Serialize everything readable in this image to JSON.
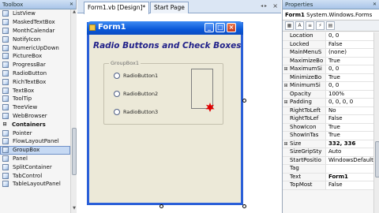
{
  "toolbox": {
    "title": "Toolbox",
    "close_glyph": "✕",
    "items": [
      {
        "label": "ListView",
        "kind": "item",
        "icon": "listview-icon"
      },
      {
        "label": "MaskedTextBox",
        "kind": "item",
        "icon": "maskedtextbox-icon"
      },
      {
        "label": "MonthCalendar",
        "kind": "item",
        "icon": "monthcalendar-icon"
      },
      {
        "label": "NotifyIcon",
        "kind": "item",
        "icon": "notifyicon-icon"
      },
      {
        "label": "NumericUpDown",
        "kind": "item",
        "icon": "numericupdown-icon"
      },
      {
        "label": "PictureBox",
        "kind": "item",
        "icon": "picturebox-icon"
      },
      {
        "label": "ProgressBar",
        "kind": "item",
        "icon": "progressbar-icon"
      },
      {
        "label": "RadioButton",
        "kind": "item",
        "icon": "radiobutton-icon"
      },
      {
        "label": "RichTextBox",
        "kind": "item",
        "icon": "richtextbox-icon"
      },
      {
        "label": "TextBox",
        "kind": "item",
        "icon": "textbox-icon"
      },
      {
        "label": "ToolTip",
        "kind": "item",
        "icon": "tooltip-icon"
      },
      {
        "label": "TreeView",
        "kind": "item",
        "icon": "treeview-icon"
      },
      {
        "label": "WebBrowser",
        "kind": "item",
        "icon": "webbrowser-icon"
      },
      {
        "label": "Containers",
        "kind": "section",
        "icon": "collapse-minus-icon"
      },
      {
        "label": "Pointer",
        "kind": "item",
        "icon": "pointer-icon"
      },
      {
        "label": "FlowLayoutPanel",
        "kind": "item",
        "icon": "flowlayoutpanel-icon"
      },
      {
        "label": "GroupBox",
        "kind": "selected",
        "icon": "groupbox-icon"
      },
      {
        "label": "Panel",
        "kind": "item",
        "icon": "panel-icon"
      },
      {
        "label": "SplitContainer",
        "kind": "item",
        "icon": "splitcontainer-icon"
      },
      {
        "label": "TabControl",
        "kind": "item",
        "icon": "tabcontrol-icon"
      },
      {
        "label": "TableLayoutPanel",
        "kind": "item",
        "icon": "tablelayoutpanel-icon"
      }
    ]
  },
  "tabs": [
    {
      "label": "Form1.vb [Design]*",
      "active": true
    },
    {
      "label": "Start Page",
      "active": false
    }
  ],
  "tab_close_glyph": "×",
  "tab_arrows": "◂ ▸",
  "form": {
    "title": "Form1",
    "heading": "Radio Buttons and Check Boxes",
    "groupbox_label": "GroupBox1",
    "radios": [
      "RadioButton1",
      "RadioButton2",
      "RadioButton3"
    ],
    "caption_glyphs": {
      "minimize": "_",
      "maximize": "□",
      "close": "×"
    },
    "accent_color": "#0a58d8",
    "heading_color": "#22228a",
    "burst_color": "#e00000"
  },
  "properties": {
    "title": "Properties",
    "close_glyph": "✕",
    "object_name": "Form1",
    "object_type": "System.Windows.Forms",
    "toolbar_glyphs": [
      "▦",
      "A",
      "≡",
      "⚡",
      "▤"
    ],
    "rows": [
      {
        "expand": "",
        "name": "Location",
        "value": "0, 0",
        "bold": false
      },
      {
        "expand": "",
        "name": "Locked",
        "value": "False",
        "bold": false
      },
      {
        "expand": "",
        "name": "MainMenuS",
        "value": "(none)",
        "bold": false
      },
      {
        "expand": "",
        "name": "MaximizeBo",
        "value": "True",
        "bold": false
      },
      {
        "expand": "⊞",
        "name": "MaximumSi",
        "value": "0, 0",
        "bold": false
      },
      {
        "expand": "",
        "name": "MinimizeBo",
        "value": "True",
        "bold": false
      },
      {
        "expand": "⊞",
        "name": "MinimumSi",
        "value": "0, 0",
        "bold": false
      },
      {
        "expand": "",
        "name": "Opacity",
        "value": "100%",
        "bold": false
      },
      {
        "expand": "⊞",
        "name": "Padding",
        "value": "0, 0, 0, 0",
        "bold": false
      },
      {
        "expand": "",
        "name": "RightToLeft",
        "value": "No",
        "bold": false
      },
      {
        "expand": "",
        "name": "RightToLef",
        "value": "False",
        "bold": false
      },
      {
        "expand": "",
        "name": "ShowIcon",
        "value": "True",
        "bold": false
      },
      {
        "expand": "",
        "name": "ShowInTas",
        "value": "True",
        "bold": false
      },
      {
        "expand": "⊞",
        "name": "Size",
        "value": "332, 336",
        "bold": true
      },
      {
        "expand": "",
        "name": "SizeGripSty",
        "value": "Auto",
        "bold": false
      },
      {
        "expand": "",
        "name": "StartPositio",
        "value": "WindowsDefault",
        "bold": false
      },
      {
        "expand": "",
        "name": "Tag",
        "value": "",
        "bold": false
      },
      {
        "expand": "",
        "name": "Text",
        "value": "Form1",
        "bold": true
      },
      {
        "expand": "",
        "name": "TopMost",
        "value": "False",
        "bold": false
      }
    ]
  }
}
